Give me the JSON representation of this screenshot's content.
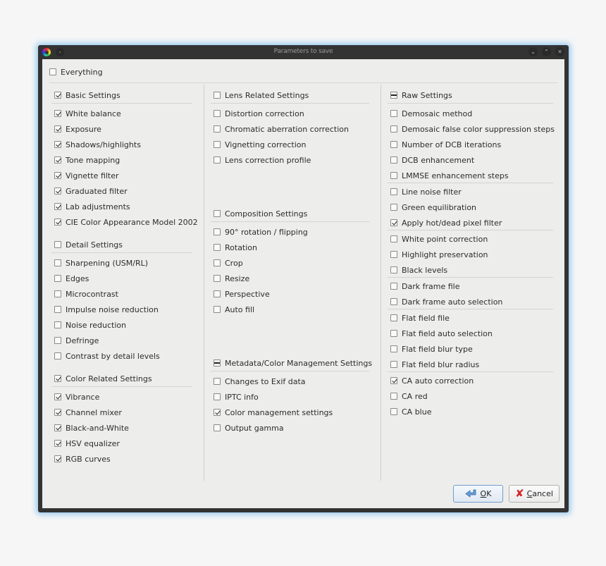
{
  "window": {
    "title": "Parameters to save",
    "controls": [
      "minimize",
      "maximize",
      "close"
    ]
  },
  "everything": {
    "label": "Everything",
    "state": "unchecked"
  },
  "columns": [
    {
      "groups": [
        {
          "header": {
            "label": "Basic Settings",
            "state": "checked"
          },
          "items": [
            {
              "label": "White balance",
              "state": "checked"
            },
            {
              "label": "Exposure",
              "state": "checked"
            },
            {
              "label": "Shadows/highlights",
              "state": "checked"
            },
            {
              "label": "Tone mapping",
              "state": "checked"
            },
            {
              "label": "Vignette filter",
              "state": "checked"
            },
            {
              "label": "Graduated filter",
              "state": "checked"
            },
            {
              "label": "Lab adjustments",
              "state": "checked"
            },
            {
              "label": "CIE Color Appearance Model 2002",
              "state": "checked"
            }
          ]
        },
        {
          "header": {
            "label": "Detail Settings",
            "state": "unchecked"
          },
          "items": [
            {
              "label": "Sharpening (USM/RL)",
              "state": "unchecked"
            },
            {
              "label": "Edges",
              "state": "unchecked"
            },
            {
              "label": "Microcontrast",
              "state": "unchecked"
            },
            {
              "label": "Impulse noise reduction",
              "state": "unchecked"
            },
            {
              "label": "Noise reduction",
              "state": "unchecked"
            },
            {
              "label": "Defringe",
              "state": "unchecked"
            },
            {
              "label": "Contrast by detail levels",
              "state": "unchecked"
            }
          ]
        },
        {
          "header": {
            "label": "Color Related Settings",
            "state": "checked"
          },
          "items": [
            {
              "label": "Vibrance",
              "state": "checked"
            },
            {
              "label": "Channel mixer",
              "state": "checked"
            },
            {
              "label": "Black-and-White",
              "state": "checked"
            },
            {
              "label": "HSV equalizer",
              "state": "checked"
            },
            {
              "label": "RGB curves",
              "state": "checked"
            }
          ]
        }
      ]
    },
    {
      "groups": [
        {
          "header": {
            "label": "Lens Related Settings",
            "state": "unchecked"
          },
          "items": [
            {
              "label": "Distortion correction",
              "state": "unchecked"
            },
            {
              "label": "Chromatic aberration correction",
              "state": "unchecked"
            },
            {
              "label": "Vignetting correction",
              "state": "unchecked"
            },
            {
              "label": "Lens correction profile",
              "state": "unchecked"
            }
          ]
        },
        {
          "header": {
            "label": "Composition Settings",
            "state": "unchecked"
          },
          "items": [
            {
              "label": "90° rotation / flipping",
              "state": "unchecked"
            },
            {
              "label": "Rotation",
              "state": "unchecked"
            },
            {
              "label": "Crop",
              "state": "unchecked"
            },
            {
              "label": "Resize",
              "state": "unchecked"
            },
            {
              "label": "Perspective",
              "state": "unchecked"
            },
            {
              "label": "Auto fill",
              "state": "unchecked"
            }
          ]
        },
        {
          "header": {
            "label": "Metadata/Color Management Settings",
            "state": "partial"
          },
          "items": [
            {
              "label": "Changes to Exif data",
              "state": "unchecked"
            },
            {
              "label": "IPTC info",
              "state": "unchecked"
            },
            {
              "label": "Color management settings",
              "state": "checked"
            },
            {
              "label": "Output gamma",
              "state": "unchecked"
            }
          ]
        }
      ]
    },
    {
      "groups": [
        {
          "header": {
            "label": "Raw Settings",
            "state": "partial"
          },
          "items": [
            {
              "label": "Demosaic method",
              "state": "unchecked"
            },
            {
              "label": "Demosaic false color suppression steps",
              "state": "unchecked"
            },
            {
              "label": "Number of DCB iterations",
              "state": "unchecked"
            },
            {
              "label": "DCB enhancement",
              "state": "unchecked"
            },
            {
              "label": "LMMSE enhancement steps",
              "state": "unchecked"
            },
            {
              "label": "Line noise filter",
              "state": "unchecked",
              "sep_before": true
            },
            {
              "label": "Green equilibration",
              "state": "unchecked"
            },
            {
              "label": "Apply hot/dead pixel filter",
              "state": "checked"
            },
            {
              "label": "White point correction",
              "state": "unchecked",
              "sep_before": true
            },
            {
              "label": "Highlight preservation",
              "state": "unchecked"
            },
            {
              "label": "Black levels",
              "state": "unchecked"
            },
            {
              "label": "Dark frame file",
              "state": "unchecked",
              "sep_before": true
            },
            {
              "label": "Dark frame auto selection",
              "state": "unchecked"
            },
            {
              "label": "Flat field file",
              "state": "unchecked",
              "sep_before": true
            },
            {
              "label": "Flat field auto selection",
              "state": "unchecked"
            },
            {
              "label": "Flat field blur type",
              "state": "unchecked"
            },
            {
              "label": "Flat field blur radius",
              "state": "unchecked"
            },
            {
              "label": "CA auto correction",
              "state": "checked",
              "sep_before": true
            },
            {
              "label": "CA red",
              "state": "unchecked"
            },
            {
              "label": "CA blue",
              "state": "unchecked"
            }
          ]
        }
      ]
    }
  ],
  "buttons": {
    "ok": {
      "mnemonic": "O",
      "rest": "K",
      "icon": "ok-arrow-icon"
    },
    "cancel": {
      "mnemonic": "C",
      "rest": "ancel",
      "icon": "cancel-x-icon"
    }
  }
}
